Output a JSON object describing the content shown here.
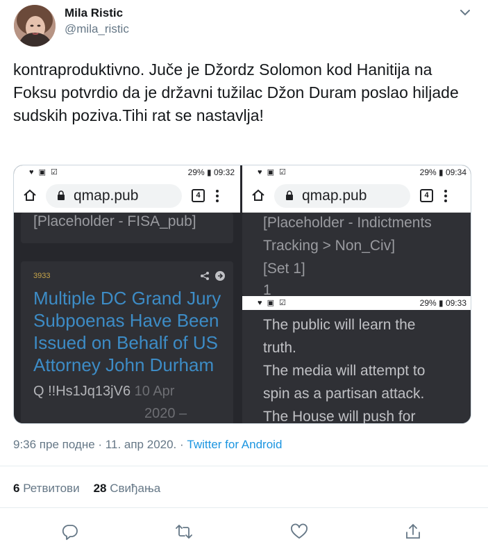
{
  "author": {
    "name": "Mila Ristic",
    "handle": "@mila_ristic"
  },
  "tweet": {
    "text": "kontraproduktivno. Juče je Džordz Solomon kod Hanitija na Foksu potvrdio da je državni tužilac Džon Duram poslao hiljade sudskih poziva.Tihi rat se nastavlja!"
  },
  "media": {
    "left": {
      "status_right": "29% ▮ 09:32",
      "url": "qmap.pub",
      "tabs_count": "4",
      "placeholder": "[Placeholder - FISA_pub]",
      "post_number": "3933",
      "post_title": "Multiple DC Grand Jury Subpoenas Have Been Issued on Behalf of US Attorney John Durham",
      "tripcode": "Q !!Hs1Jq13jV6",
      "date_line1": "10 Apr",
      "date_line2": "2020 –"
    },
    "right": {
      "status_right_top": "29% ▮ 09:34",
      "status_right_mid": "29% ▮ 09:33",
      "url": "qmap.pub",
      "tabs_count": "4",
      "placeholder_line1": "[Placeholder - Indictments",
      "placeholder_line2": "Tracking > Non_Civ]",
      "placeholder_line3": "[Set 1]",
      "placeholder_line4": "1",
      "body_line1": "The public will learn the",
      "body_line2": "truth.",
      "body_line3": "The media will attempt to",
      "body_line4": "spin as a partisan attack.",
      "body_line5": "The House will push for"
    }
  },
  "meta": {
    "time_date": "9:36 пре подне · 11. апр 2020. · ",
    "client": "Twitter for Android"
  },
  "stats": {
    "retweets_count": "6",
    "retweets_label": "Ретвитови",
    "likes_count": "28",
    "likes_label": "Свиђања"
  },
  "icons": {
    "reply": "reply-icon",
    "retweet": "retweet-icon",
    "like": "heart-icon",
    "share": "share-icon",
    "accent": "#1b95e0"
  }
}
